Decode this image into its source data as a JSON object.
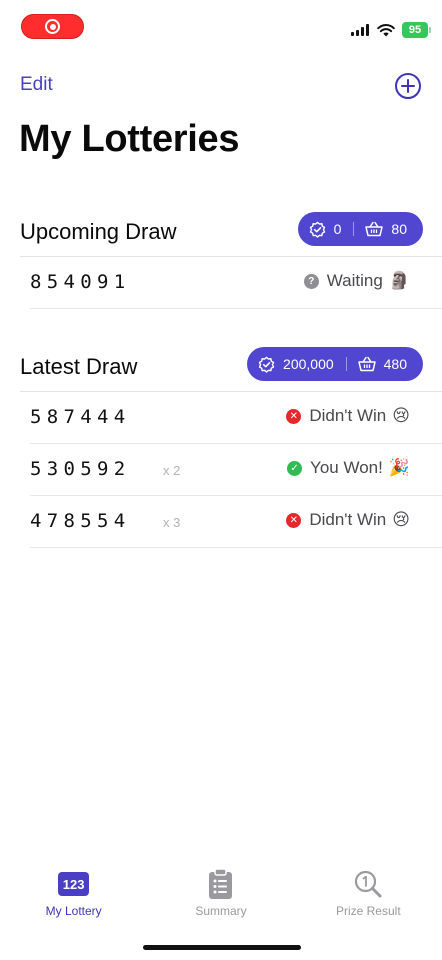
{
  "status_bar": {
    "battery": "95"
  },
  "nav": {
    "edit_label": "Edit"
  },
  "page_title": "My Lotteries",
  "upcoming": {
    "title": "Upcoming Draw",
    "stats": {
      "verified_count": "0",
      "basket_count": "80"
    },
    "tickets": [
      {
        "number": "854091",
        "multiplier": "",
        "status": "Waiting",
        "status_type": "wait",
        "emoji": "🗿"
      }
    ]
  },
  "latest": {
    "title": "Latest Draw",
    "stats": {
      "verified_count": "200,000",
      "basket_count": "480"
    },
    "tickets": [
      {
        "number": "587444",
        "multiplier": "",
        "status": "Didn't Win",
        "status_type": "lose",
        "emoji": "😢"
      },
      {
        "number": "530592",
        "multiplier": "x 2",
        "status": "You Won!",
        "status_type": "win",
        "emoji": "🎉"
      },
      {
        "number": "478554",
        "multiplier": "x 3",
        "status": "Didn't Win",
        "status_type": "lose",
        "emoji": "😢"
      }
    ]
  },
  "tab_bar": {
    "tabs": [
      {
        "label": "My Lottery",
        "icon": "lottery-123-icon",
        "icon_text": "123",
        "active": true
      },
      {
        "label": "Summary",
        "icon": "clipboard-icon",
        "active": false
      },
      {
        "label": "Prize Result",
        "icon": "magnifier-icon",
        "active": false
      }
    ]
  },
  "colors": {
    "accent": "#5146cf",
    "win": "#2ebd55",
    "lose": "#e8262b",
    "wait": "#8e8e93"
  }
}
